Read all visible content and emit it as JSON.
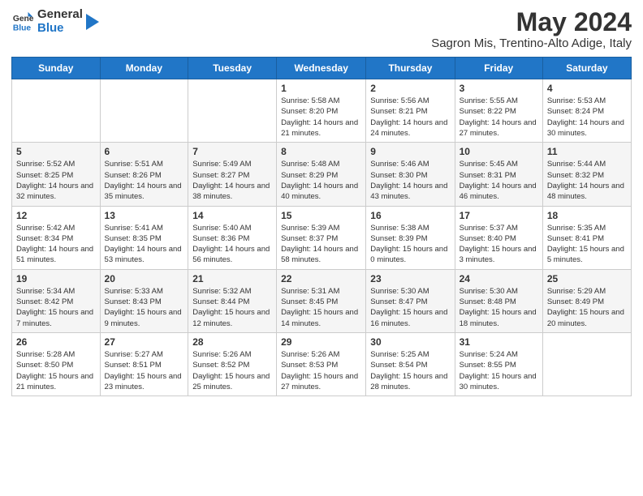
{
  "header": {
    "logo_line1": "General",
    "logo_line2": "Blue",
    "main_title": "May 2024",
    "subtitle": "Sagron Mis, Trentino-Alto Adige, Italy"
  },
  "days_of_week": [
    "Sunday",
    "Monday",
    "Tuesday",
    "Wednesday",
    "Thursday",
    "Friday",
    "Saturday"
  ],
  "weeks": [
    [
      {
        "day": "",
        "info": ""
      },
      {
        "day": "",
        "info": ""
      },
      {
        "day": "",
        "info": ""
      },
      {
        "day": "1",
        "info": "Sunrise: 5:58 AM\nSunset: 8:20 PM\nDaylight: 14 hours and 21 minutes."
      },
      {
        "day": "2",
        "info": "Sunrise: 5:56 AM\nSunset: 8:21 PM\nDaylight: 14 hours and 24 minutes."
      },
      {
        "day": "3",
        "info": "Sunrise: 5:55 AM\nSunset: 8:22 PM\nDaylight: 14 hours and 27 minutes."
      },
      {
        "day": "4",
        "info": "Sunrise: 5:53 AM\nSunset: 8:24 PM\nDaylight: 14 hours and 30 minutes."
      }
    ],
    [
      {
        "day": "5",
        "info": "Sunrise: 5:52 AM\nSunset: 8:25 PM\nDaylight: 14 hours and 32 minutes."
      },
      {
        "day": "6",
        "info": "Sunrise: 5:51 AM\nSunset: 8:26 PM\nDaylight: 14 hours and 35 minutes."
      },
      {
        "day": "7",
        "info": "Sunrise: 5:49 AM\nSunset: 8:27 PM\nDaylight: 14 hours and 38 minutes."
      },
      {
        "day": "8",
        "info": "Sunrise: 5:48 AM\nSunset: 8:29 PM\nDaylight: 14 hours and 40 minutes."
      },
      {
        "day": "9",
        "info": "Sunrise: 5:46 AM\nSunset: 8:30 PM\nDaylight: 14 hours and 43 minutes."
      },
      {
        "day": "10",
        "info": "Sunrise: 5:45 AM\nSunset: 8:31 PM\nDaylight: 14 hours and 46 minutes."
      },
      {
        "day": "11",
        "info": "Sunrise: 5:44 AM\nSunset: 8:32 PM\nDaylight: 14 hours and 48 minutes."
      }
    ],
    [
      {
        "day": "12",
        "info": "Sunrise: 5:42 AM\nSunset: 8:34 PM\nDaylight: 14 hours and 51 minutes."
      },
      {
        "day": "13",
        "info": "Sunrise: 5:41 AM\nSunset: 8:35 PM\nDaylight: 14 hours and 53 minutes."
      },
      {
        "day": "14",
        "info": "Sunrise: 5:40 AM\nSunset: 8:36 PM\nDaylight: 14 hours and 56 minutes."
      },
      {
        "day": "15",
        "info": "Sunrise: 5:39 AM\nSunset: 8:37 PM\nDaylight: 14 hours and 58 minutes."
      },
      {
        "day": "16",
        "info": "Sunrise: 5:38 AM\nSunset: 8:39 PM\nDaylight: 15 hours and 0 minutes."
      },
      {
        "day": "17",
        "info": "Sunrise: 5:37 AM\nSunset: 8:40 PM\nDaylight: 15 hours and 3 minutes."
      },
      {
        "day": "18",
        "info": "Sunrise: 5:35 AM\nSunset: 8:41 PM\nDaylight: 15 hours and 5 minutes."
      }
    ],
    [
      {
        "day": "19",
        "info": "Sunrise: 5:34 AM\nSunset: 8:42 PM\nDaylight: 15 hours and 7 minutes."
      },
      {
        "day": "20",
        "info": "Sunrise: 5:33 AM\nSunset: 8:43 PM\nDaylight: 15 hours and 9 minutes."
      },
      {
        "day": "21",
        "info": "Sunrise: 5:32 AM\nSunset: 8:44 PM\nDaylight: 15 hours and 12 minutes."
      },
      {
        "day": "22",
        "info": "Sunrise: 5:31 AM\nSunset: 8:45 PM\nDaylight: 15 hours and 14 minutes."
      },
      {
        "day": "23",
        "info": "Sunrise: 5:30 AM\nSunset: 8:47 PM\nDaylight: 15 hours and 16 minutes."
      },
      {
        "day": "24",
        "info": "Sunrise: 5:30 AM\nSunset: 8:48 PM\nDaylight: 15 hours and 18 minutes."
      },
      {
        "day": "25",
        "info": "Sunrise: 5:29 AM\nSunset: 8:49 PM\nDaylight: 15 hours and 20 minutes."
      }
    ],
    [
      {
        "day": "26",
        "info": "Sunrise: 5:28 AM\nSunset: 8:50 PM\nDaylight: 15 hours and 21 minutes."
      },
      {
        "day": "27",
        "info": "Sunrise: 5:27 AM\nSunset: 8:51 PM\nDaylight: 15 hours and 23 minutes."
      },
      {
        "day": "28",
        "info": "Sunrise: 5:26 AM\nSunset: 8:52 PM\nDaylight: 15 hours and 25 minutes."
      },
      {
        "day": "29",
        "info": "Sunrise: 5:26 AM\nSunset: 8:53 PM\nDaylight: 15 hours and 27 minutes."
      },
      {
        "day": "30",
        "info": "Sunrise: 5:25 AM\nSunset: 8:54 PM\nDaylight: 15 hours and 28 minutes."
      },
      {
        "day": "31",
        "info": "Sunrise: 5:24 AM\nSunset: 8:55 PM\nDaylight: 15 hours and 30 minutes."
      },
      {
        "day": "",
        "info": ""
      }
    ]
  ]
}
